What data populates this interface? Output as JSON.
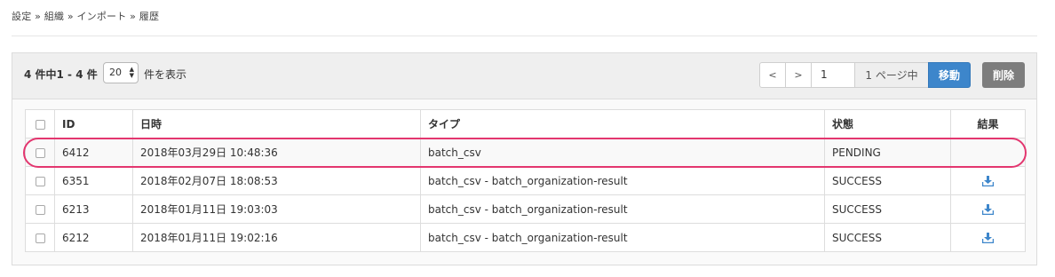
{
  "breadcrumb": "設定 » 組織 » インポート » 履歴",
  "toolbar": {
    "count_text": "4 件中1 - 4 件",
    "per_page_value": "20",
    "per_page_label": "件を表示",
    "prev_label": "<",
    "next_label": ">",
    "page_input_value": "1",
    "page_of_label": "1 ページ中",
    "go_label": "移動",
    "delete_label": "削除"
  },
  "table": {
    "headers": [
      "ID",
      "日時",
      "タイプ",
      "状態",
      "結果"
    ],
    "rows": [
      {
        "id": "6412",
        "datetime": "2018年03月29日 10:48:36",
        "type": "batch_csv",
        "status": "PENDING",
        "has_result": false
      },
      {
        "id": "6351",
        "datetime": "2018年02月07日 18:08:53",
        "type": "batch_csv - batch_organization-result",
        "status": "SUCCESS",
        "has_result": true
      },
      {
        "id": "6213",
        "datetime": "2018年01月11日 19:03:03",
        "type": "batch_csv - batch_organization-result",
        "status": "SUCCESS",
        "has_result": true
      },
      {
        "id": "6212",
        "datetime": "2018年01月11日 19:02:16",
        "type": "batch_csv - batch_organization-result",
        "status": "SUCCESS",
        "has_result": true
      }
    ]
  },
  "icons": {
    "download": "download-icon",
    "select_arrows": "select-arrows-icon"
  },
  "colors": {
    "primary": "#3d86cb",
    "danger_gray": "#7d7d7d",
    "highlight": "#e3366f",
    "download": "#3d86cb"
  }
}
